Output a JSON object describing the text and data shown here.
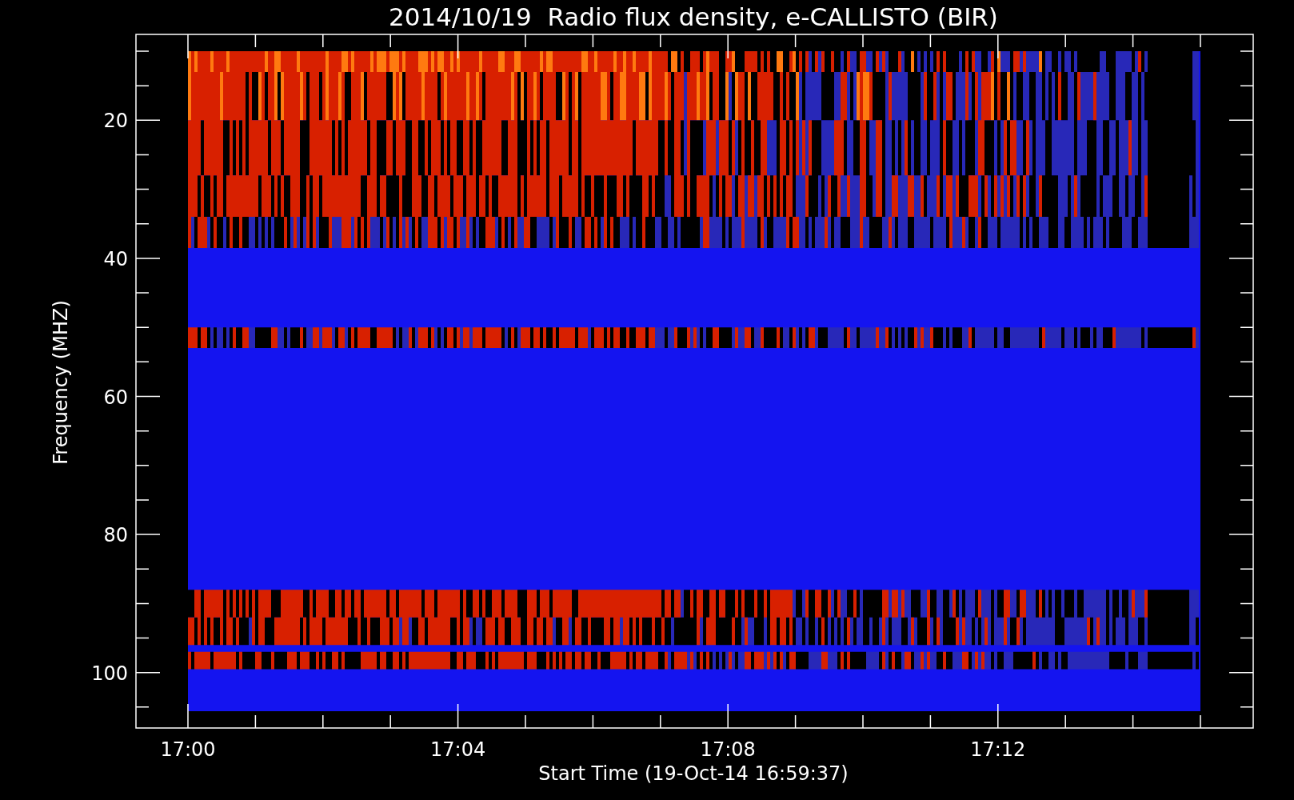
{
  "plot": {
    "title": "2014/10/19  Radio flux density, e-CALLISTO (BIR)",
    "ylabel": "Frequency (MHZ)",
    "xlabel": "Start Time (19-Oct-14 16:59:37)",
    "yticks": [
      {
        "label": "20"
      },
      {
        "label": "40"
      },
      {
        "label": "60"
      },
      {
        "label": "80"
      },
      {
        "label": "100"
      }
    ],
    "xticks": [
      {
        "label": "17:00"
      },
      {
        "label": "17:04"
      },
      {
        "label": "17:08"
      },
      {
        "label": "17:12"
      }
    ]
  }
}
